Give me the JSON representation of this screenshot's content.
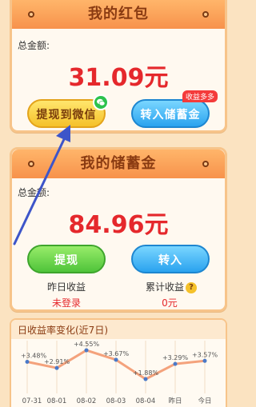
{
  "red_packet": {
    "title": "我的红包",
    "total_label": "总金额:",
    "amount": "31.09元",
    "withdraw_button": "提现到微信",
    "transfer_button": "转入储蓄金",
    "transfer_badge": "收益多多"
  },
  "savings": {
    "title": "我的储蓄金",
    "total_label": "总金额:",
    "amount": "84.96元",
    "withdraw_button": "提现",
    "transfer_button": "转入",
    "yesterday_label": "昨日收益",
    "yesterday_value": "未登录",
    "cumulative_label": "累计收益",
    "cumulative_value": "0元",
    "help_glyph": "?"
  },
  "chart": {
    "title": "日收益率变化(近7日)"
  },
  "chart_data": {
    "type": "line",
    "title": "日收益率变化(近7日)",
    "categories": [
      "07-31",
      "08-01",
      "08-02",
      "08-03",
      "08-04",
      "昨日",
      "今日"
    ],
    "series": [
      {
        "values": [
          3.48,
          2.91,
          4.55,
          3.67,
          1.88,
          3.29,
          3.57
        ],
        "labels": [
          "+3.48%",
          "+2.91%",
          "+4.55%",
          "+3.67%",
          "+1.88%",
          "+3.29%",
          "+3.57%"
        ]
      }
    ],
    "ylim": [
      1.0,
      5.0
    ],
    "grid": true,
    "line_color": "#f4a27c",
    "point_color": "#4a79c8"
  },
  "colors": {
    "amount": "#e5282c",
    "header": "#f7924b",
    "arrow": "#3d55c9"
  }
}
